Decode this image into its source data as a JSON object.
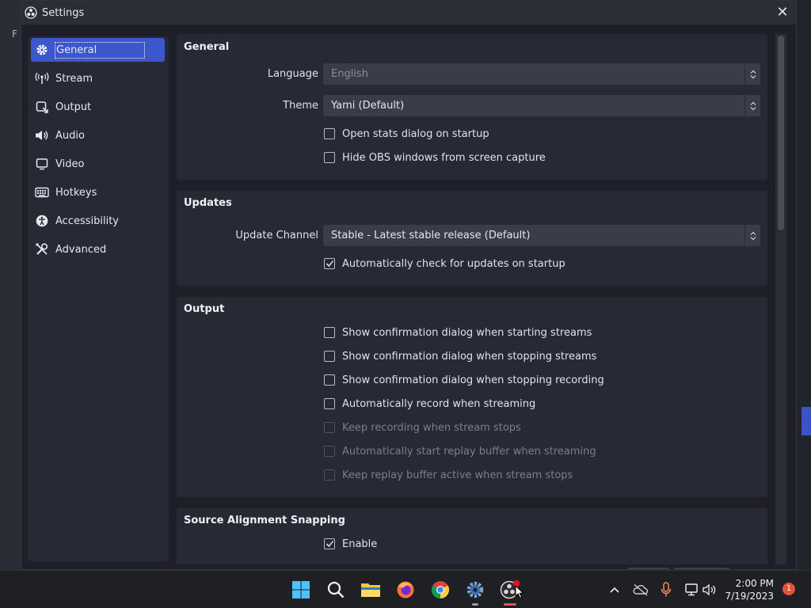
{
  "window": {
    "title": "Settings",
    "close_glyph": "✕"
  },
  "background": {
    "left_text": "F"
  },
  "sidebar": {
    "items": [
      {
        "label": "General",
        "icon": "gear-icon",
        "active": true
      },
      {
        "label": "Stream",
        "icon": "broadcast-icon"
      },
      {
        "label": "Output",
        "icon": "output-icon"
      },
      {
        "label": "Audio",
        "icon": "speaker-icon"
      },
      {
        "label": "Video",
        "icon": "monitor-icon"
      },
      {
        "label": "Hotkeys",
        "icon": "keyboard-icon"
      },
      {
        "label": "Accessibility",
        "icon": "accessibility-icon"
      },
      {
        "label": "Advanced",
        "icon": "tools-icon"
      }
    ]
  },
  "general": {
    "title": "General",
    "language_label": "Language",
    "language_value": "English",
    "theme_label": "Theme",
    "theme_value": "Yami (Default)",
    "open_stats_label": "Open stats dialog on startup",
    "hide_obs_label": "Hide OBS windows from screen capture"
  },
  "updates": {
    "title": "Updates",
    "channel_label": "Update Channel",
    "channel_value": "Stable - Latest stable release (Default)",
    "auto_check_label": "Automatically check for updates on startup"
  },
  "output": {
    "title": "Output",
    "options": [
      {
        "label": "Show confirmation dialog when starting streams",
        "checked": false,
        "disabled": false
      },
      {
        "label": "Show confirmation dialog when stopping streams",
        "checked": false,
        "disabled": false
      },
      {
        "label": "Show confirmation dialog when stopping recording",
        "checked": false,
        "disabled": false
      },
      {
        "label": "Automatically record when streaming",
        "checked": false,
        "disabled": false
      },
      {
        "label": "Keep recording when stream stops",
        "checked": false,
        "disabled": true
      },
      {
        "label": "Automatically start replay buffer when streaming",
        "checked": false,
        "disabled": true
      },
      {
        "label": "Keep replay buffer active when stream stops",
        "checked": false,
        "disabled": true
      }
    ]
  },
  "snapping": {
    "title": "Source Alignment Snapping",
    "enable_label": "Enable"
  },
  "taskbar": {
    "time": "2:00 PM",
    "date": "7/19/2023",
    "notification_count": "1"
  },
  "colors": {
    "accent": "#3c56cc",
    "panel": "#272934",
    "window_bg": "#1e1f28"
  }
}
